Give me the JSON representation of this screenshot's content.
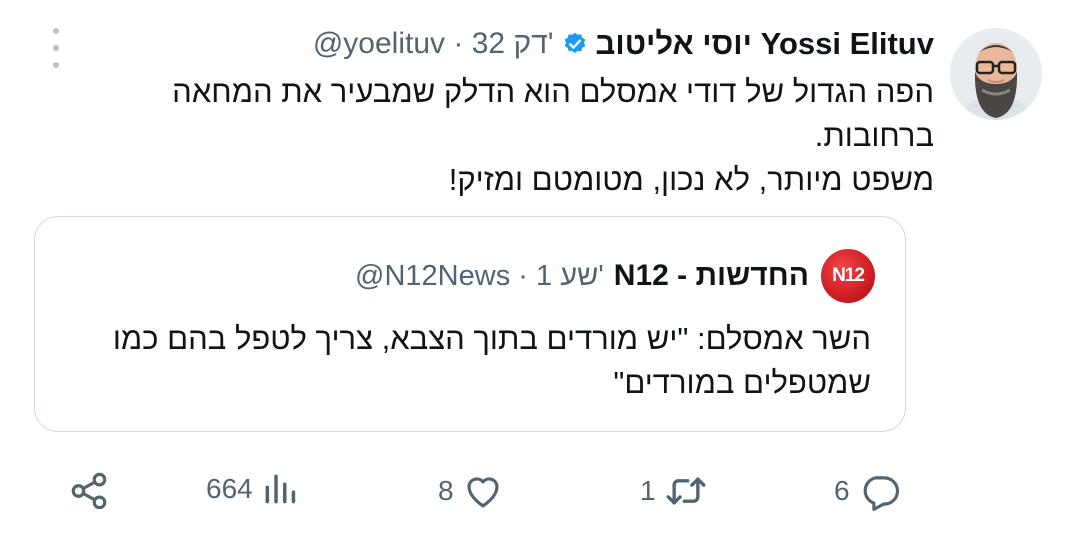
{
  "tweet": {
    "author_name": "יוסי אליטוב Yossi Elituv",
    "handle": "@yoelituv",
    "separator": "·",
    "time": "32 דק'",
    "text_lines": [
      "הפה הגדול של דודי אמסלם הוא הדלק שמבעיר את המחאה ברחובות.",
      "משפט מיותר, לא נכון, מטומטם ומזיק!"
    ],
    "avatar_icon": "author-avatar",
    "verified_icon": "verified-badge-icon",
    "more_icon": "more-options-icon"
  },
  "quoted": {
    "logo_text": "N12",
    "author_name": "החדשות - N12",
    "handle": "@N12News",
    "separator": "·",
    "time": "1 שע'",
    "text": "השר אמסלם: \"יש מורדים בתוך הצבא, צריך לטפל בהם כמו שמטפלים במורדים\""
  },
  "actions": {
    "replies": "6",
    "retweets": "1",
    "likes": "8",
    "views": "664",
    "share_icon": "share-icon"
  },
  "colors": {
    "text": "#0f1419",
    "muted": "#536471",
    "verified": "#1d9bf0",
    "border": "#cfd9de",
    "n12_red": "#d0202a"
  }
}
